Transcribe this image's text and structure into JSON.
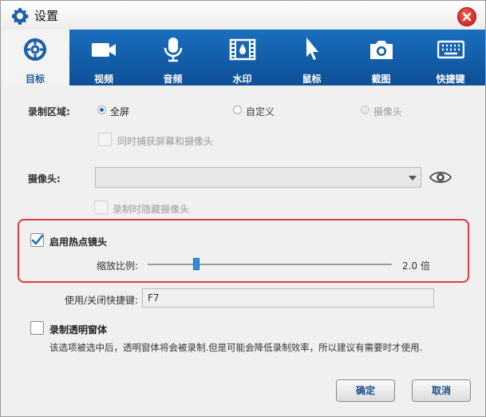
{
  "window": {
    "title": "设置"
  },
  "tabs": [
    {
      "label": "目标",
      "icon": "crosshair-icon",
      "active": true
    },
    {
      "label": "视频",
      "icon": "video-camera-icon"
    },
    {
      "label": "音频",
      "icon": "microphone-icon"
    },
    {
      "label": "水印",
      "icon": "film-watermark-icon"
    },
    {
      "label": "鼠标",
      "icon": "cursor-icon"
    },
    {
      "label": "截图",
      "icon": "camera-icon"
    },
    {
      "label": "快捷键",
      "icon": "keyboard-icon"
    }
  ],
  "record_area": {
    "label": "录制区域:",
    "options": [
      "全屏",
      "自定义",
      "摄像头"
    ],
    "selected": "全屏",
    "capture_both_label": "同时捕获屏幕和摄像头"
  },
  "webcam": {
    "label": "摄像头:",
    "selected_value": "",
    "hide_on_record_label": "录制时隐藏摄像头"
  },
  "hotspot_zoom": {
    "enable_label": "启用热点镜头",
    "enabled": true,
    "zoom_label": "缩放比例:",
    "zoom_value": 2.0,
    "zoom_value_text": "2.0 倍",
    "zoom_min": 1.0,
    "zoom_max": 6.0,
    "hotkey_label": "使用/关闭快捷键:",
    "hotkey_value": "F7"
  },
  "transparent_window": {
    "label": "录制透明窗体",
    "checked": false,
    "description": "该选项被选中后，透明窗体将会被录制.但是可能会降低录制效率，所以建议有需要时才使用."
  },
  "buttons": {
    "ok": "确定",
    "cancel": "取消"
  },
  "colors": {
    "tab_bar": "#1a6fbf",
    "accent": "#1e6bc6",
    "highlight_border": "#e23b3b",
    "close_button": "#d42a2a"
  }
}
